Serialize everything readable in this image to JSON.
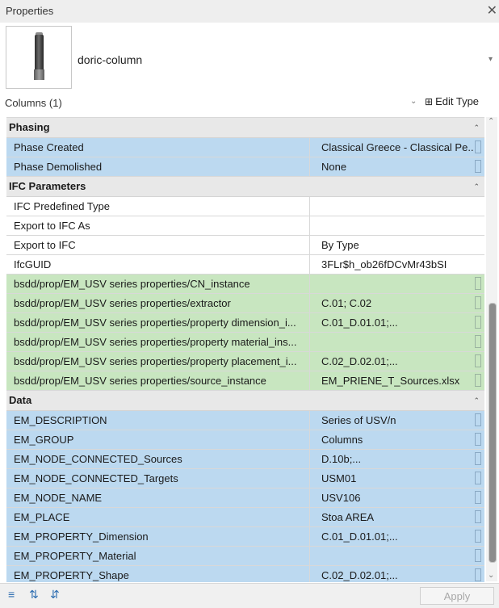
{
  "window": {
    "title": "Properties",
    "close_icon": "close-icon"
  },
  "type_selector": {
    "name": "doric-column",
    "image": "doric-column-thumbnail",
    "dropdown_icon": "chevron-down-icon"
  },
  "instance_filter": {
    "label": "Columns (1)",
    "edit_type_label": "Edit Type",
    "edit_type_icon": "edit-type-icon"
  },
  "groups": [
    {
      "title": "Phasing",
      "rows": [
        {
          "key": "Phase Created",
          "value": "Classical Greece - Classical Pe...",
          "style": "blue"
        },
        {
          "key": "Phase Demolished",
          "value": "None",
          "style": "blue"
        }
      ]
    },
    {
      "title": "IFC Parameters",
      "rows": [
        {
          "key": "IFC Predefined Type",
          "value": "",
          "style": "white"
        },
        {
          "key": "Export to IFC As",
          "value": "",
          "style": "white"
        },
        {
          "key": "Export to IFC",
          "value": "By Type",
          "style": "white"
        },
        {
          "key": "IfcGUID",
          "value": "3FLr$h_ob26fDCvMr43bSI",
          "style": "white"
        },
        {
          "key": "bsdd/prop/EM_USV series properties/CN_instance",
          "value": "",
          "style": "green"
        },
        {
          "key": "bsdd/prop/EM_USV series properties/extractor",
          "value": "C.01; C.02",
          "style": "green"
        },
        {
          "key": "bsdd/prop/EM_USV series properties/property dimension_i...",
          "value": "C.01_D.01.01;...",
          "style": "green"
        },
        {
          "key": "bsdd/prop/EM_USV series properties/property material_ins...",
          "value": "",
          "style": "green"
        },
        {
          "key": "bsdd/prop/EM_USV series properties/property placement_i...",
          "value": "C.02_D.02.01;...",
          "style": "green"
        },
        {
          "key": "bsdd/prop/EM_USV series properties/source_instance",
          "value": "EM_PRIENE_T_Sources.xlsx",
          "style": "green"
        }
      ]
    },
    {
      "title": "Data",
      "rows": [
        {
          "key": "EM_DESCRIPTION",
          "value": "Series of USV/n",
          "style": "blue"
        },
        {
          "key": "EM_GROUP",
          "value": "Columns",
          "style": "blue"
        },
        {
          "key": "EM_NODE_CONNECTED_Sources",
          "value": "D.10b;...",
          "style": "blue"
        },
        {
          "key": "EM_NODE_CONNECTED_Targets",
          "value": "USM01",
          "style": "blue"
        },
        {
          "key": "EM_NODE_NAME",
          "value": "USV106",
          "style": "blue"
        },
        {
          "key": "EM_PLACE",
          "value": "Stoa AREA",
          "style": "blue"
        },
        {
          "key": "EM_PROPERTY_Dimension",
          "value": "C.01_D.01.01;...",
          "style": "blue"
        },
        {
          "key": "EM_PROPERTY_Material",
          "value": "",
          "style": "blue"
        },
        {
          "key": "EM_PROPERTY_Shape",
          "value": "C.02_D.02.01;...",
          "style": "blue"
        }
      ]
    }
  ],
  "footer": {
    "toolbar_icons": [
      "categorize-icon",
      "sort-ascending-icon",
      "sort-descending-icon"
    ],
    "apply_label": "Apply"
  },
  "colors": {
    "blue_row": "#bcd9f0",
    "green_row": "#c8e6c0",
    "group_header": "#e8e8e8"
  }
}
